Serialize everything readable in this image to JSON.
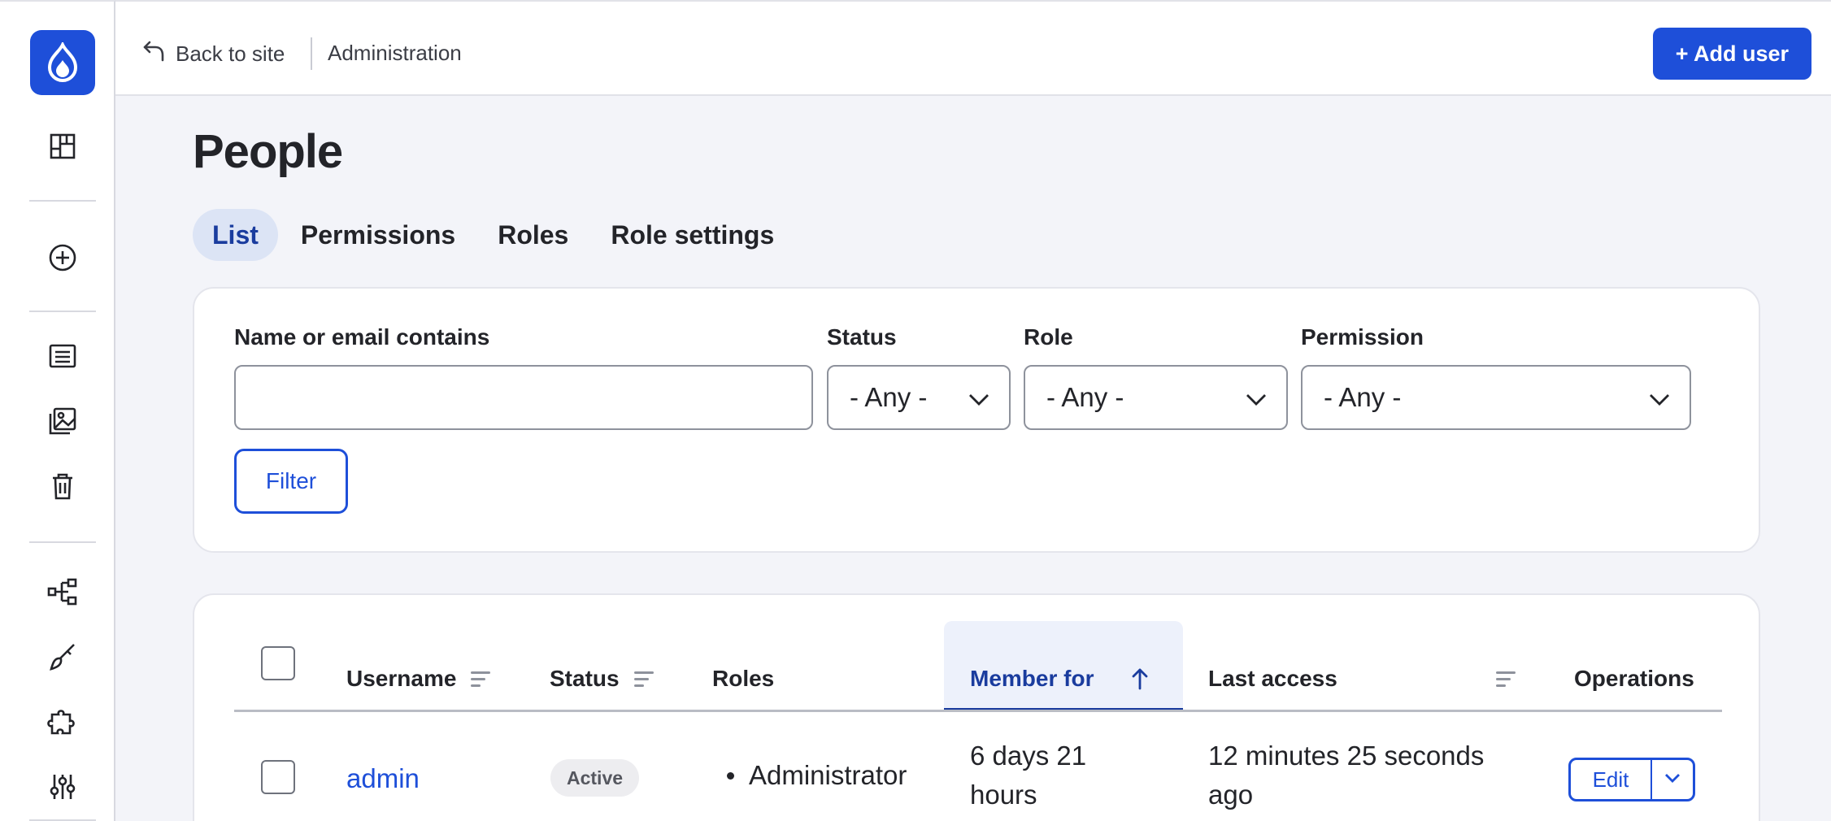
{
  "topbar": {
    "back_label": "Back to site",
    "breadcrumb": "Administration",
    "add_user_label": "+ Add user"
  },
  "page": {
    "title": "People"
  },
  "tabs": [
    {
      "label": "List",
      "active": true
    },
    {
      "label": "Permissions"
    },
    {
      "label": "Roles"
    },
    {
      "label": "Role settings"
    }
  ],
  "filters": {
    "name_label": "Name or email contains",
    "name_value": "",
    "status_label": "Status",
    "status_value": "- Any -",
    "role_label": "Role",
    "role_value": "- Any -",
    "permission_label": "Permission",
    "permission_value": "- Any -",
    "filter_button": "Filter"
  },
  "table": {
    "columns": {
      "username": "Username",
      "status": "Status",
      "roles": "Roles",
      "member_for": "Member for",
      "last_access": "Last access",
      "operations": "Operations"
    },
    "sorted_column": "member_for",
    "rows": [
      {
        "username": "admin",
        "status": "Active",
        "roles": "Administrator",
        "member_for_1": "6 days 21",
        "member_for_2": "hours",
        "last_access_1": "12 minutes 25 seconds",
        "last_access_2": "ago",
        "edit": "Edit"
      }
    ]
  },
  "colors": {
    "accent": "#1e4fd9",
    "accent_dark": "#1a3c9e",
    "background": "#f3f4f9"
  },
  "icons": [
    "drupal-logo-icon",
    "dashboard-icon",
    "add-content-icon",
    "content-icon",
    "media-icon",
    "trash-icon",
    "structure-icon",
    "appearance-icon",
    "extend-icon",
    "configuration-icon"
  ]
}
